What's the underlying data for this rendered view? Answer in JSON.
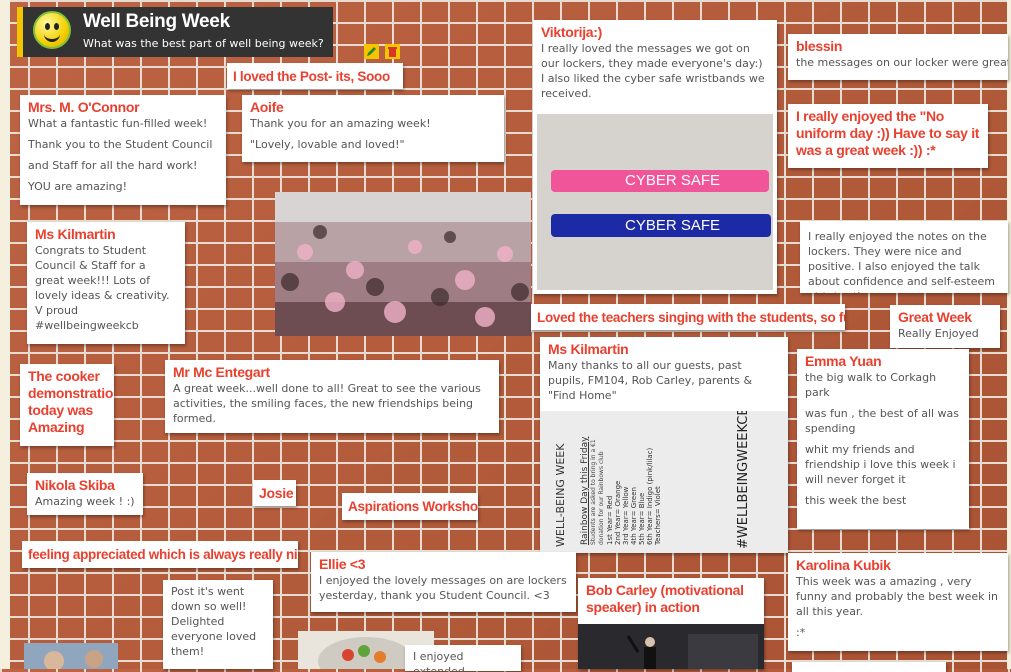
{
  "header": {
    "title": "Well Being Week",
    "subtitle": "What was the best part of well being week?"
  },
  "posts": {
    "post_its": {
      "title": "I loved the Post- its, Sooo cute"
    },
    "oconnor": {
      "title": "Mrs. M. O'Connor",
      "lines": [
        "What a fantastic fun-filled week!",
        "Thank you to the Student Council",
        "and Staff for all the hard work!",
        "YOU are amazing!"
      ]
    },
    "aoife": {
      "title": "Aoife",
      "lines": [
        "Thank you for an amazing week!",
        "\"Lovely,  lovable and loved!\""
      ]
    },
    "viktorija": {
      "title": "Viktorija:)",
      "body": "I really loved the messages we got on our lockers, they made everyone's day:) I also liked the cyber safe wristbands we received.",
      "wristband_1": "CYBER SAFE",
      "wristband_2": "CYBER SAFE"
    },
    "blessin": {
      "title": "blessin",
      "body": "the messages on our locker were great"
    },
    "no_uniform": {
      "title": "I really enjoyed the \"No uniform day :)) Have to say it was a great week :)) :*"
    },
    "kilmartin1": {
      "title": "Ms Kilmartin",
      "body": "Congrats to Student Council & Staff for a great week!!! Lots of lovely ideas & creativity. V proud #wellbeingweekcb"
    },
    "notes_lockers": {
      "body": "I really enjoyed the notes on the lockers. They were nice and positive. I also enjoyed the talk about confidence and self-esteem at tutor time."
    },
    "teachers_singing": {
      "title": "Loved the teachers singing with the students, so funny!!"
    },
    "great_week": {
      "title": "Great Week",
      "body": "Really Enjoyed"
    },
    "cooker": {
      "title": "The cooker demonstration today was Amazing"
    },
    "mc_entegart": {
      "title": "Mr Mc Entegart",
      "body": "A great week...well done to all! Great to see the various activities, the smiling faces, the new friendships being formed."
    },
    "kilmartin2": {
      "title": "Ms Kilmartin",
      "body": "Many thanks to all our guests, past pupils, FM104,  Rob Carley, parents & \"Find Home\"",
      "poster_left": "WELL-BEING WEEK",
      "poster_heading": "Rainbow Day this Friday",
      "poster_note": "Students are asked to bring in a €1 donation for our Rainbows club",
      "poster_years": [
        "1st Year= Red",
        "2nd Year= Orange",
        "3rd Year= Yellow",
        "4th Year= Green",
        "5th Year= Blue",
        "6th Year= Indigo (pink/lilac)",
        "Teachers= Violet"
      ],
      "poster_tag": "#WELLBEINGWEEKCB"
    },
    "emma": {
      "title": "Emma Yuan",
      "lines": [
        "the big walk to Corkagh park",
        "was fun , the best of all was spending",
        "whit my friends and friendship i love this week  i will never forget it",
        "this week the best"
      ]
    },
    "nikola": {
      "title": "Nikola Skiba",
      "body": "Amazing  week ! :)"
    },
    "josie": {
      "title": "Josie"
    },
    "aspirations": {
      "title": "Aspirations Workshop"
    },
    "appreciated": {
      "title": "feeling appreciated which is always really nice :)"
    },
    "ellie": {
      "title": "Ellie <3",
      "body": "I enjoyed the lovely messages on are lockers yesterday, thank you Student Council. <3"
    },
    "bob": {
      "title": "Bob Carley (motivational speaker) in action"
    },
    "karolina": {
      "title": "Karolina Kubik",
      "body": "This week was a amazing , very funny and probably the best week in all this year.",
      "extra": ":*"
    },
    "post_went": {
      "body": "Post it's went down so well! Delighted everyone loved them!"
    },
    "extended": {
      "body": "I enjoyed extended"
    }
  }
}
